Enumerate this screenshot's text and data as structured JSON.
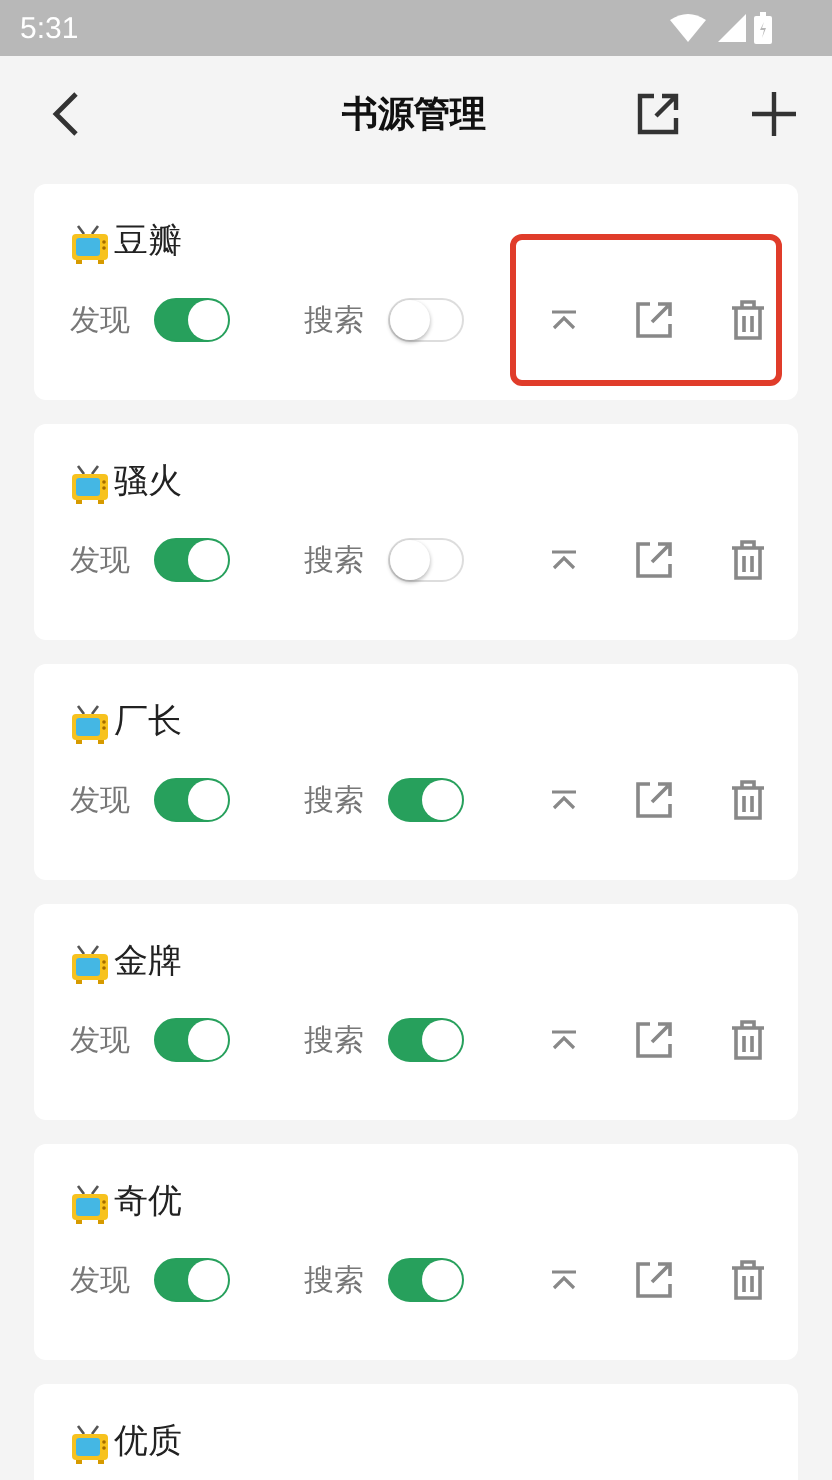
{
  "status_bar": {
    "time": "5:31"
  },
  "header": {
    "title": "书源管理"
  },
  "sources": [
    {
      "name": "豆瓣",
      "discover": {
        "label": "发现",
        "on": true
      },
      "search": {
        "label": "搜索",
        "on": false
      },
      "highlighted": true
    },
    {
      "name": "骚火",
      "discover": {
        "label": "发现",
        "on": true
      },
      "search": {
        "label": "搜索",
        "on": false
      },
      "highlighted": false
    },
    {
      "name": "厂长",
      "discover": {
        "label": "发现",
        "on": true
      },
      "search": {
        "label": "搜索",
        "on": true
      },
      "highlighted": false
    },
    {
      "name": "金牌",
      "discover": {
        "label": "发现",
        "on": true
      },
      "search": {
        "label": "搜索",
        "on": true
      },
      "highlighted": false
    },
    {
      "name": "奇优",
      "discover": {
        "label": "发现",
        "on": true
      },
      "search": {
        "label": "搜索",
        "on": true
      },
      "highlighted": false
    },
    {
      "name": "优质"
    }
  ]
}
